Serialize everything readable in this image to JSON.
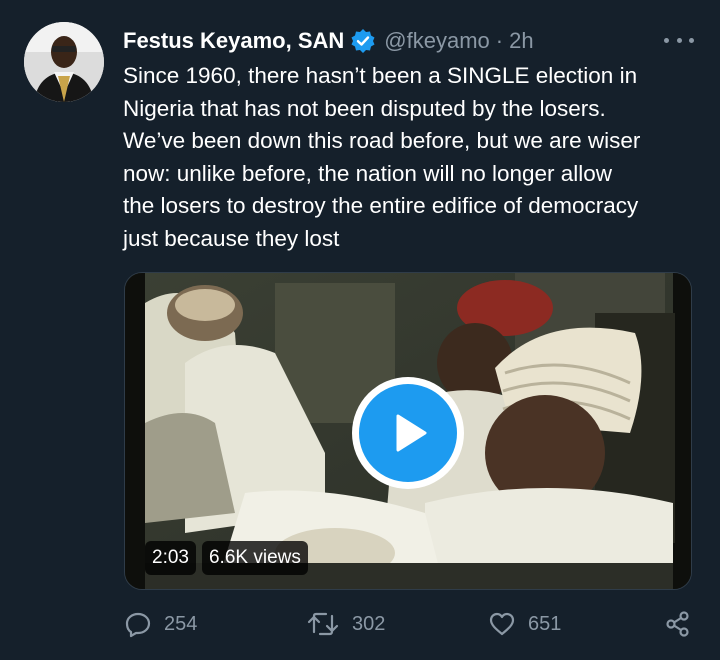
{
  "author": {
    "display_name": "Festus Keyamo, SAN",
    "handle": "@fkeyamo",
    "separator": "·",
    "time": "2h",
    "verified_icon": "verified-badge-icon",
    "avatar_icon": "profile-avatar"
  },
  "tweet": {
    "text": "Since 1960, there hasn’t been a SINGLE election in\nNigeria that has not been disputed by the losers.\nWe’ve been down this road before, but we are wiser\nnow: unlike before, the nation will no longer allow\nthe losers to destroy the entire edifice of democracy\njust because they lost"
  },
  "media": {
    "duration": "2:03",
    "views": "6.6K views",
    "play_icon": "play-icon"
  },
  "actions": {
    "replies": "254",
    "retweets": "302",
    "likes": "651",
    "share_icon": "share-icon"
  },
  "colors": {
    "background": "#15202b",
    "accent": "#1d9bf0",
    "muted": "#8b98a5"
  }
}
